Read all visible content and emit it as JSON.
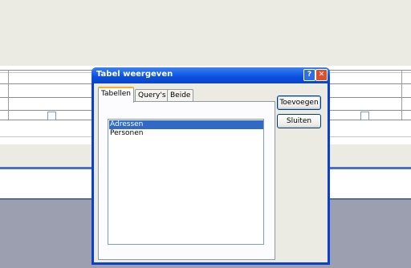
{
  "dialog": {
    "title": "Tabel weergeven",
    "help_glyph": "?",
    "close_glyph": "✕",
    "tabs": [
      {
        "label": "Tabellen",
        "active": true
      },
      {
        "label": "Query's",
        "active": false
      },
      {
        "label": "Beide",
        "active": false
      }
    ],
    "list_items": [
      {
        "label": "Adressen",
        "selected": true
      },
      {
        "label": "Personen",
        "selected": false
      }
    ],
    "add_button": "Toevoegen",
    "close_button": "Sluiten"
  },
  "colors": {
    "titlebar": "#0b4fe0",
    "selection": "#316ac5",
    "dialog_body": "#ecebe3",
    "workspace": "#9c9fb0"
  }
}
